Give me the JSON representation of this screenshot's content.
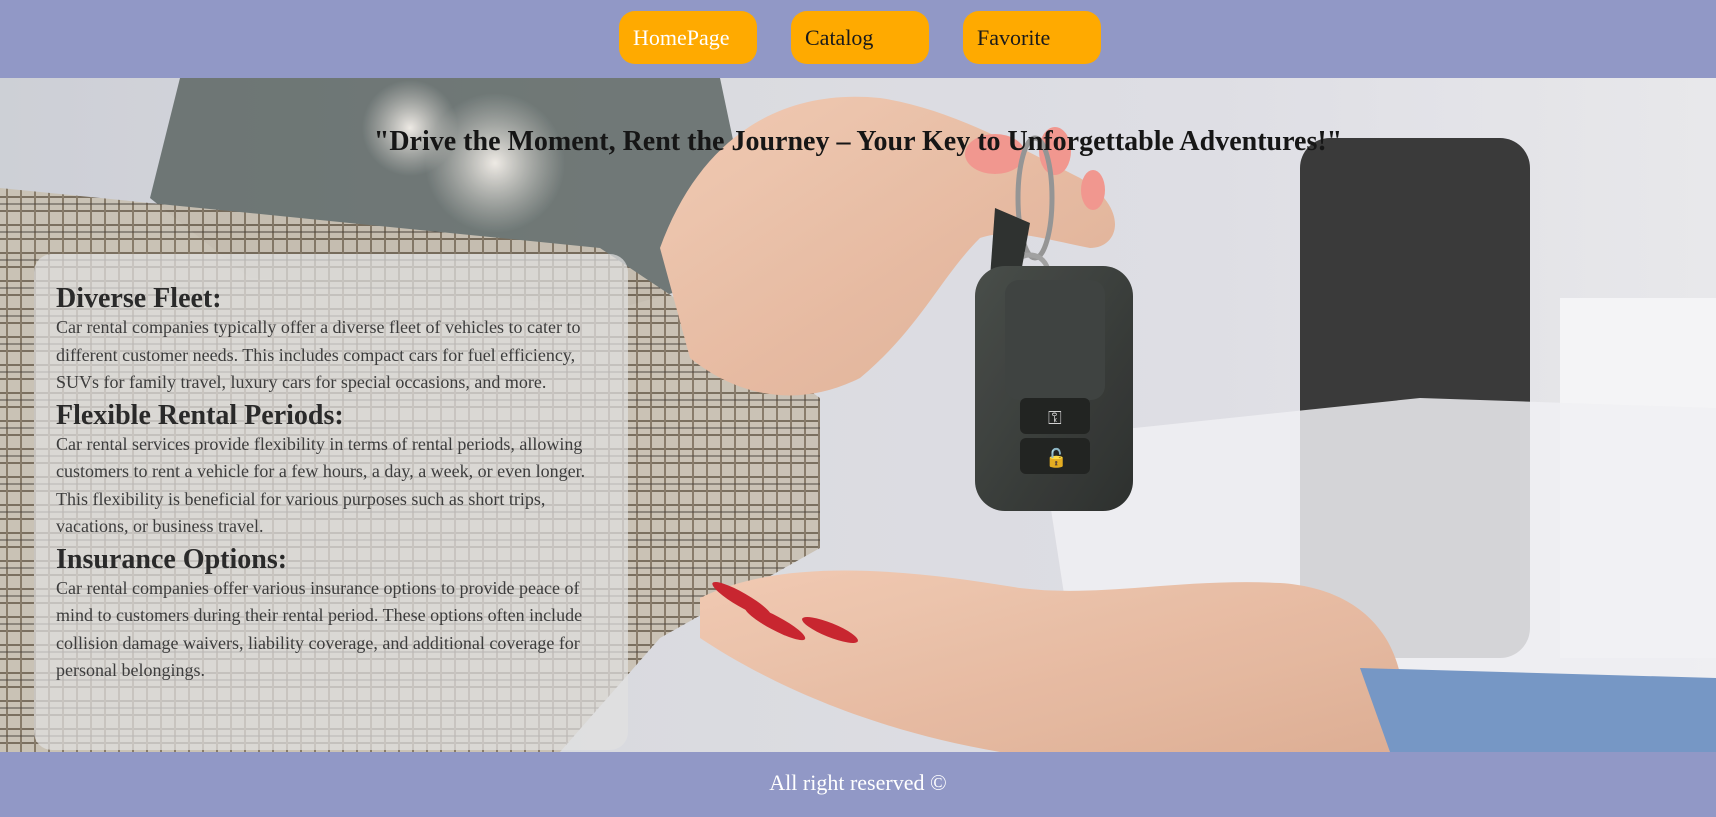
{
  "nav": {
    "items": [
      {
        "label": "HomePage",
        "active": true
      },
      {
        "label": "Catalog",
        "active": false
      },
      {
        "label": "Favorite",
        "active": false
      }
    ]
  },
  "hero": {
    "tagline": "\"Drive the Moment, Rent the Journey – Your Key to Unforgettable Adventures!\"",
    "background_image": "hands passing car key fob"
  },
  "info": {
    "sections": [
      {
        "heading": "Diverse Fleet:",
        "text": "Car rental companies typically offer a diverse fleet of vehicles to cater to different customer needs. This includes compact cars for fuel efficiency, SUVs for family travel, luxury cars for special occasions, and more."
      },
      {
        "heading": "Flexible Rental Periods:",
        "text": "Car rental services provide flexibility in terms of rental periods, allowing customers to rent a vehicle for a few hours, a day, a week, or even longer. This flexibility is beneficial for various purposes such as short trips, vacations, or business travel."
      },
      {
        "heading": "Insurance Options:",
        "text": "Car rental companies offer various insurance options to provide peace of mind to customers during their rental period. These options often include collision damage waivers, liability coverage, and additional coverage for personal belongings."
      }
    ]
  },
  "footer": {
    "text": "All right reserved ©"
  },
  "colors": {
    "header_bg": "#9198c6",
    "button_bg": "#ffaa00",
    "footer_bg": "#9198c6"
  }
}
